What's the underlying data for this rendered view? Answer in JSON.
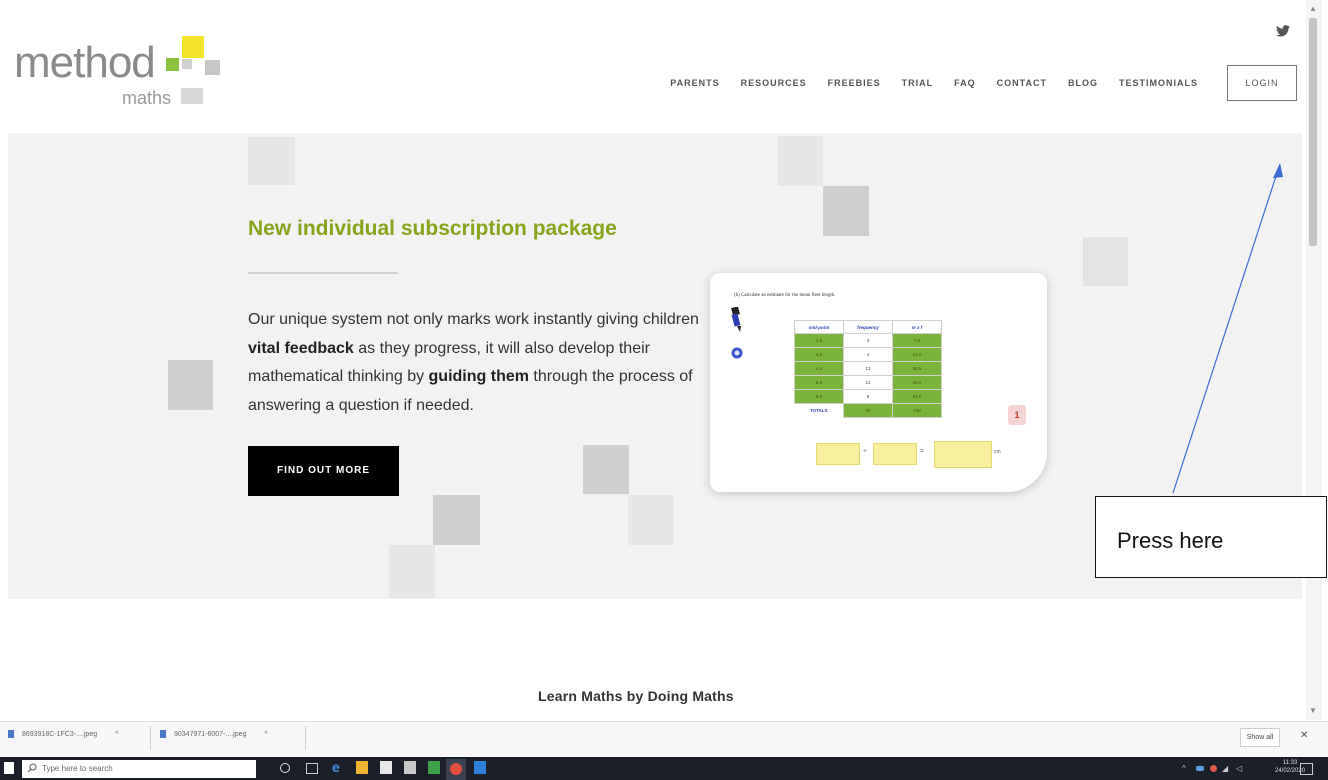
{
  "brand": {
    "word": "method",
    "sub": "maths"
  },
  "nav": {
    "items": [
      "PARENTS",
      "RESOURCES",
      "FREEBIES",
      "TRIAL",
      "FAQ",
      "CONTACT",
      "BLOG",
      "TESTIMONIALS"
    ],
    "login_label": "LOGIN"
  },
  "social": {
    "icon": "twitter-icon"
  },
  "hero": {
    "title": "New individual subscription package",
    "text_1": "Our unique system not only marks work instantly giving children ",
    "bold_1": "vital feedback",
    "text_2": " as they progress, it will also develop their mathematical thinking by ",
    "bold_2": "guiding them",
    "text_3": " through the process of answering a question if needed.",
    "cta_label": "FIND OUT MORE"
  },
  "worksheet": {
    "question": "(b) Calculate an estimate for the mean fleet length.",
    "headers": [
      "mid-point",
      "frequency",
      "m x f"
    ],
    "rows": [
      [
        "2.5",
        "3",
        "7.5"
      ],
      [
        "3.5",
        "4",
        "14.0"
      ],
      [
        "4.5",
        "13",
        "58.5"
      ],
      [
        "5.5",
        "12",
        "66.0"
      ],
      [
        "6.5",
        "8",
        "52.0"
      ]
    ],
    "totals_label": "TOTALS",
    "totals": [
      "40",
      "198"
    ],
    "badge": "1",
    "op_1": "÷",
    "op_2": "=",
    "unit": "cm"
  },
  "annotation": {
    "text": "Press here"
  },
  "section": {
    "title": "Learn Maths by Doing Maths"
  },
  "downloads": {
    "items": [
      "8693918C-1FC3-....jpeg",
      "90347971-6007-....jpeg"
    ],
    "show_all": "Show all",
    "close": "✕"
  },
  "taskbar": {
    "search_placeholder": "Type here to search",
    "time": "11:33",
    "date": "24/02/2020"
  },
  "colors": {
    "accent": "#86a41c",
    "logo_yellow": "#f2e32b",
    "logo_green": "#8ac43f",
    "logo_grey": "#c6c6c6"
  }
}
